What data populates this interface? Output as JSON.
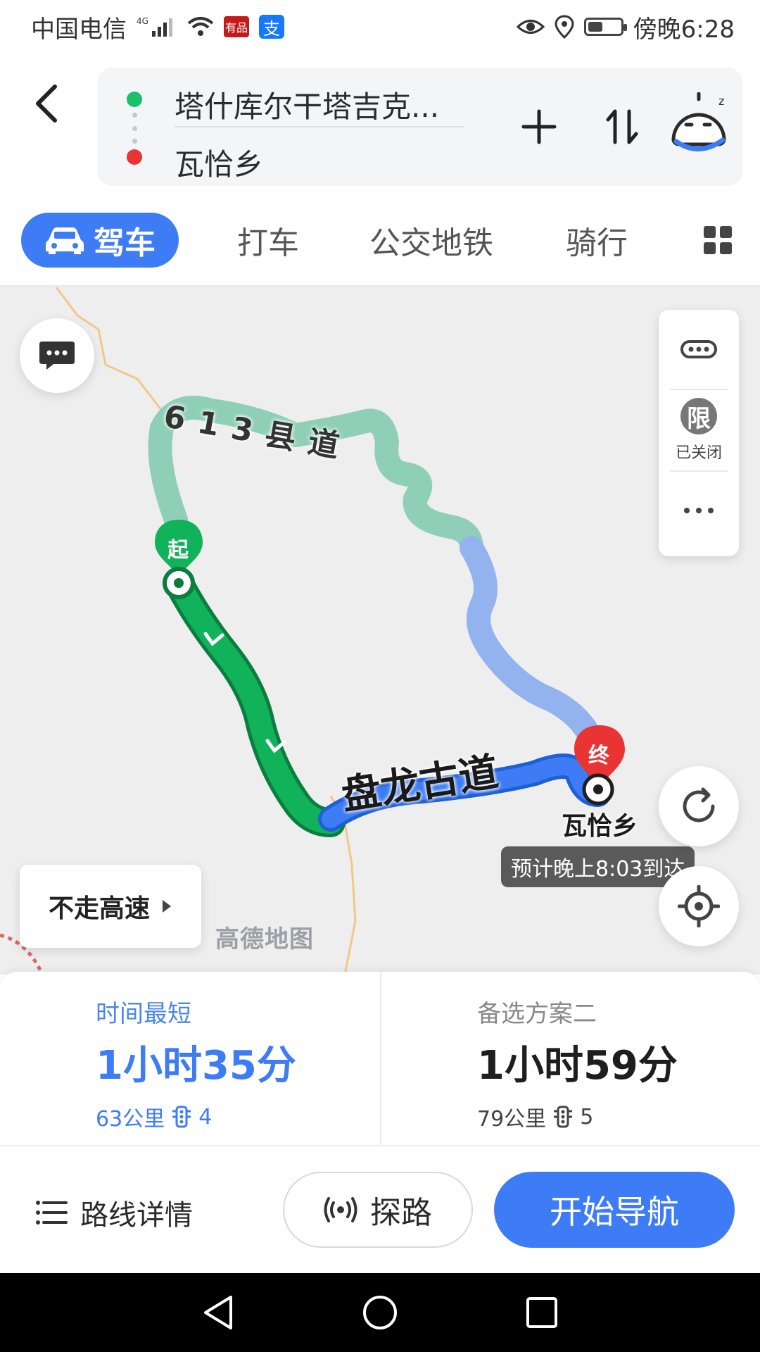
{
  "status_bar": {
    "carrier": "中国电信",
    "network": "4G",
    "time": "傍晚6:28",
    "badge_app": "有品",
    "badge_pay": "支",
    "battery_level": 0.45
  },
  "header": {
    "start": "塔什库尔干塔吉克...",
    "destination": "瓦恰乡"
  },
  "tabs": {
    "drive": "驾车",
    "taxi": "打车",
    "transit": "公交地铁",
    "bike": "骑行"
  },
  "map": {
    "road_name": "盘龙古道",
    "county_road": "613县道",
    "start_marker": "起",
    "end_marker": "终",
    "destination_label": "瓦恰乡",
    "eta": "预计晚上8:03到达",
    "credit": "高德地图",
    "no_highway": "不走高速",
    "limit_badge": "限",
    "limit_status": "已关闭",
    "colors": {
      "selected_route": "#11b35a",
      "selected_route_blue": "#3d7cf5",
      "alt_route_green": "#8fcfb8",
      "alt_route_blue": "#93b3ee",
      "boundary": "#f0c98a"
    }
  },
  "routes": [
    {
      "label": "时间最短",
      "time": "1小时35分",
      "distance": "63公里",
      "lights": "4"
    },
    {
      "label": "备选方案二",
      "time": "1小时59分",
      "distance": "79公里",
      "lights": "5"
    }
  ],
  "actions": {
    "details": "路线详情",
    "explore": "探路",
    "navigate": "开始导航"
  }
}
